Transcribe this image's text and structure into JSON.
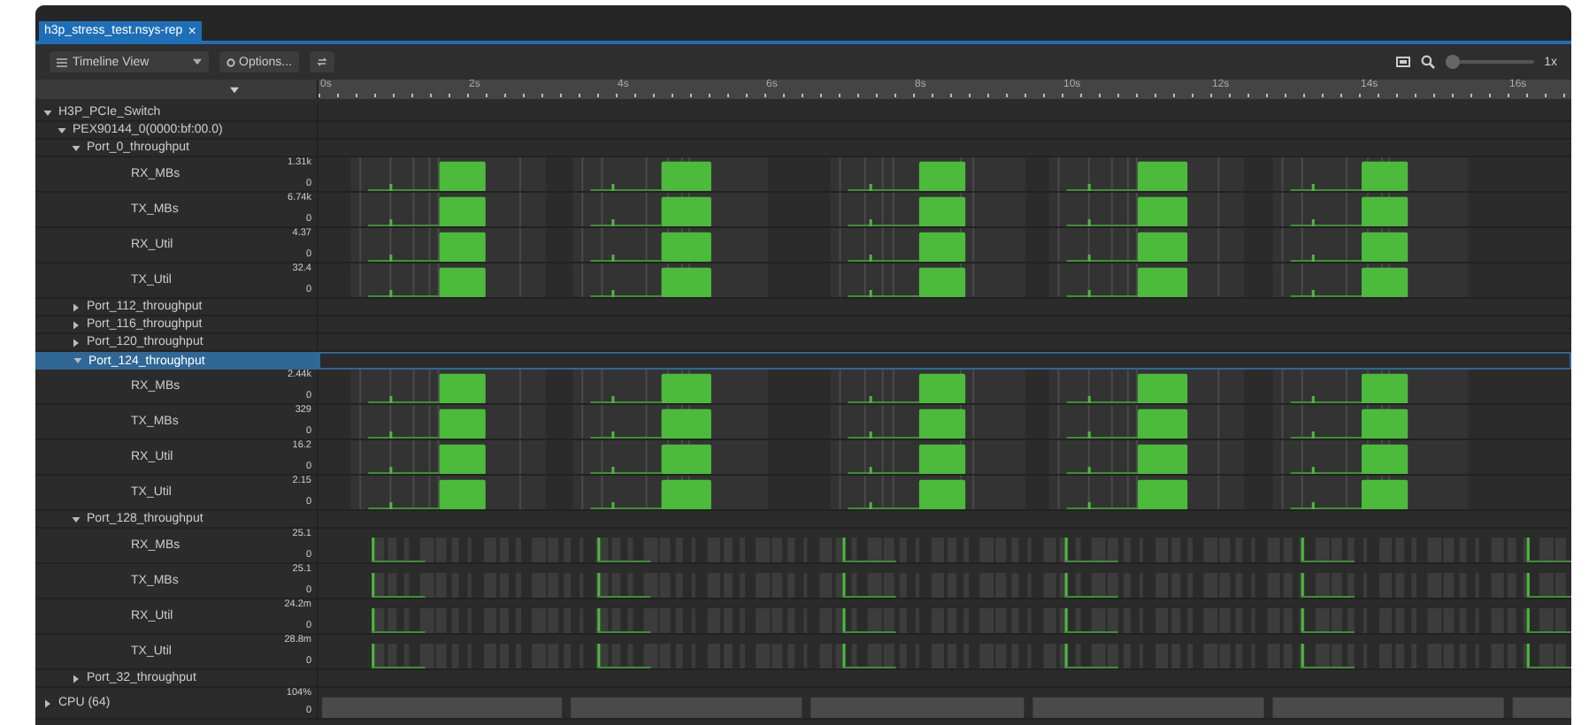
{
  "tab": {
    "title": "h3p_stress_test.nsys-rep",
    "close": "×",
    "selected": true
  },
  "toolbar": {
    "view_select": "Timeline View",
    "options_button": "Options...",
    "zoom_slider": {
      "level": 0.0
    },
    "zoom_label": "1x"
  },
  "ruler": {
    "ticks": [
      "0s",
      "2s",
      "4s",
      "6s",
      "8s",
      "10s",
      "12s",
      "14s",
      "16s"
    ]
  },
  "tree": [
    {
      "label": "H3P_PCIe_Switch",
      "expanded": true,
      "selected": false,
      "children": [
        {
          "label": "PEX90144_0(0000:bf:00.0)",
          "expanded": true,
          "selected": false,
          "children": [
            {
              "label": "Port_0_throughput",
              "expanded": true,
              "selected": false,
              "children": [
                {
                  "label": "RX_MBs",
                  "max": "1.31k",
                  "min": "0",
                  "kind": "burst"
                },
                {
                  "label": "TX_MBs",
                  "max": "6.74k",
                  "min": "0",
                  "kind": "burst"
                },
                {
                  "label": "RX_Util",
                  "max": "4.37",
                  "min": "0",
                  "kind": "burst"
                },
                {
                  "label": "TX_Util",
                  "max": "32.4",
                  "min": "0",
                  "kind": "burst"
                }
              ]
            },
            {
              "label": "Port_112_throughput",
              "expanded": false,
              "selected": false
            },
            {
              "label": "Port_116_throughput",
              "expanded": false,
              "selected": false
            },
            {
              "label": "Port_120_throughput",
              "expanded": false,
              "selected": false
            },
            {
              "label": "Port_124_throughput",
              "expanded": true,
              "selected": true,
              "children": [
                {
                  "label": "RX_MBs",
                  "max": "2.44k",
                  "min": "0",
                  "kind": "burst"
                },
                {
                  "label": "TX_MBs",
                  "max": "329",
                  "min": "0",
                  "kind": "burst"
                },
                {
                  "label": "RX_Util",
                  "max": "16.2",
                  "min": "0",
                  "kind": "burst"
                },
                {
                  "label": "TX_Util",
                  "max": "2.15",
                  "min": "0",
                  "kind": "burst"
                }
              ]
            },
            {
              "label": "Port_128_throughput",
              "expanded": true,
              "selected": false,
              "children": [
                {
                  "label": "RX_MBs",
                  "max": "25.1",
                  "min": "0",
                  "kind": "spikes"
                },
                {
                  "label": "TX_MBs",
                  "max": "25.1",
                  "min": "0",
                  "kind": "spikes"
                },
                {
                  "label": "RX_Util",
                  "max": "24.2m",
                  "min": "0",
                  "kind": "spikes"
                },
                {
                  "label": "TX_Util",
                  "max": "28.8m",
                  "min": "0",
                  "kind": "spikes"
                }
              ]
            },
            {
              "label": "Port_32_throughput",
              "expanded": false,
              "selected": false
            }
          ]
        }
      ]
    },
    {
      "label": "CPU (64)",
      "expanded": false,
      "selected": false,
      "max": "104%",
      "min": "0",
      "kind": "blocks"
    }
  ]
}
